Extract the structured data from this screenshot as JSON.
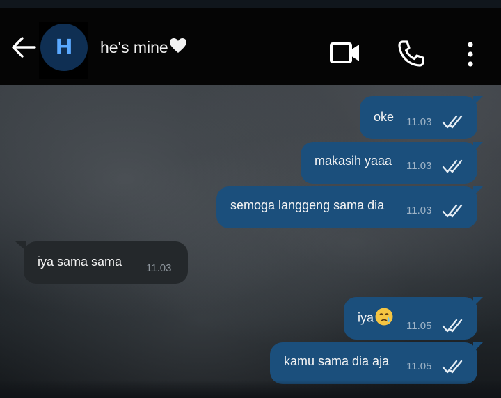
{
  "header": {
    "avatar_initial": "H",
    "contact_name": "he's mine"
  },
  "icons": {
    "back": "arrow-left-icon",
    "video": "video-call-icon",
    "phone": "voice-call-icon",
    "more": "more-vertical-icon",
    "read": "double-check-icon",
    "heart": "white-heart-emoji",
    "emoji": "crying-face-emoji"
  },
  "colors": {
    "outgoing_bubble": "#1b4f7c",
    "incoming_bubble": "#24282b",
    "avatar_bg": "#0f2f53",
    "avatar_text": "#5aa9ff"
  },
  "messages": [
    {
      "direction": "out",
      "text": "oke",
      "time": "11.03",
      "status": "read"
    },
    {
      "direction": "out",
      "text": "makasih yaaa",
      "time": "11.03",
      "status": "read"
    },
    {
      "direction": "out",
      "text": "semoga langgeng sama dia",
      "time": "11.03",
      "status": "read"
    },
    {
      "direction": "in",
      "text": "iya sama sama",
      "time": "11.03"
    },
    {
      "direction": "out",
      "text": "iya",
      "time": "11.05",
      "status": "read"
    },
    {
      "direction": "out",
      "text": "kamu sama dia aja",
      "time": "11.05",
      "status": "read"
    }
  ]
}
